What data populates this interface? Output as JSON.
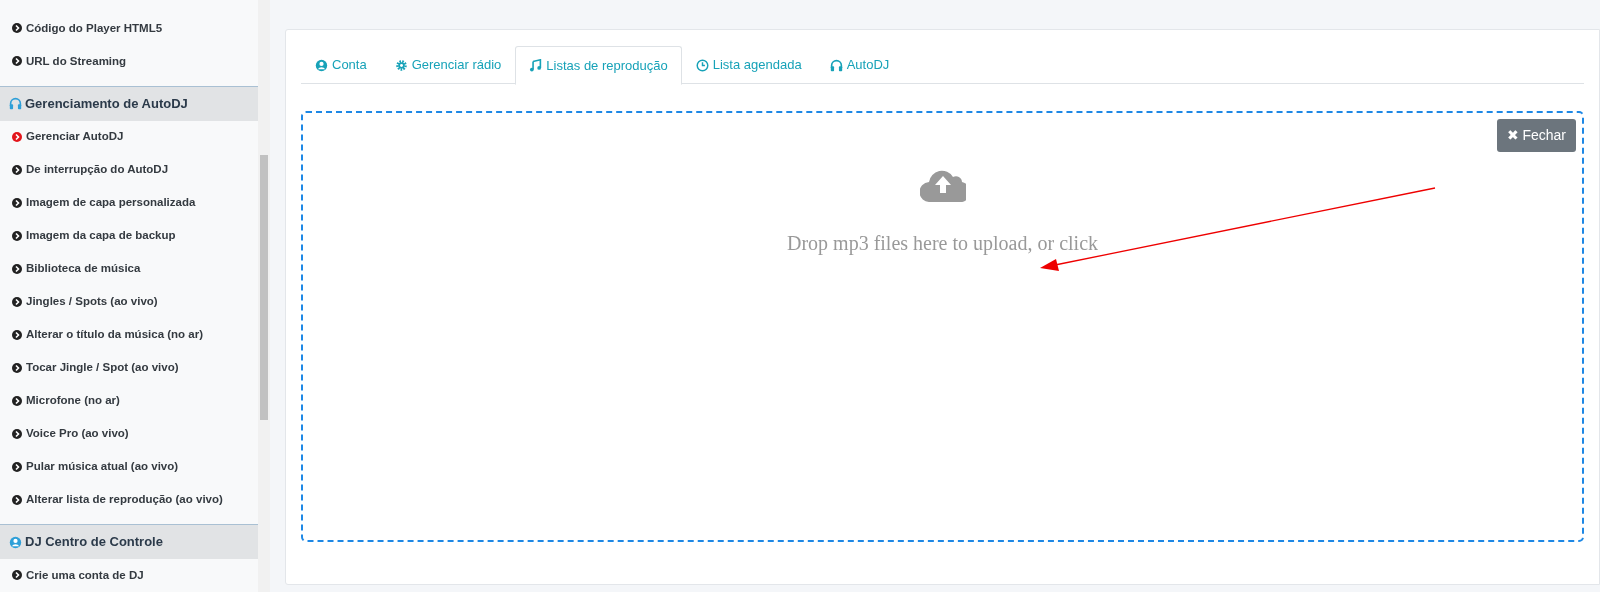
{
  "sidebar": {
    "items": [
      {
        "kind": "item",
        "label": "Código do Player HTML5",
        "selected": false
      },
      {
        "kind": "item",
        "label": "URL do Streaming",
        "selected": false
      },
      {
        "kind": "header",
        "label": "Gerenciamento de AutoDJ"
      },
      {
        "kind": "item",
        "label": "Gerenciar AutoDJ",
        "selected": true
      },
      {
        "kind": "item",
        "label": "De interrupção do AutoDJ",
        "selected": false
      },
      {
        "kind": "item",
        "label": "Imagem de capa personalizada",
        "selected": false
      },
      {
        "kind": "item",
        "label": "Imagem da capa de backup",
        "selected": false
      },
      {
        "kind": "item",
        "label": "Biblioteca de música",
        "selected": false
      },
      {
        "kind": "item",
        "label": "Jingles / Spots (ao vivo)",
        "selected": false
      },
      {
        "kind": "item",
        "label": "Alterar o título da música (no ar)",
        "selected": false
      },
      {
        "kind": "item",
        "label": "Tocar Jingle / Spot (ao vivo)",
        "selected": false
      },
      {
        "kind": "item",
        "label": "Microfone (no ar)",
        "selected": false
      },
      {
        "kind": "item",
        "label": "Voice Pro (ao vivo)",
        "selected": false
      },
      {
        "kind": "item",
        "label": "Pular música atual (ao vivo)",
        "selected": false
      },
      {
        "kind": "item",
        "label": "Alterar lista de reprodução (ao vivo)",
        "selected": false
      },
      {
        "kind": "header",
        "label": "DJ Centro de Controle"
      },
      {
        "kind": "item",
        "label": "Crie uma conta de DJ",
        "selected": false
      }
    ]
  },
  "tabs": [
    {
      "label": "Conta",
      "selected": false
    },
    {
      "label": "Gerenciar rádio",
      "selected": false
    },
    {
      "label": "Listas de reprodução",
      "selected": true
    },
    {
      "label": "Lista agendada",
      "selected": false
    },
    {
      "label": "AutoDJ",
      "selected": false
    }
  ],
  "dropzone": {
    "close_button": "✖ Fechar",
    "message": "Drop mp3 files here to upload, or click"
  }
}
